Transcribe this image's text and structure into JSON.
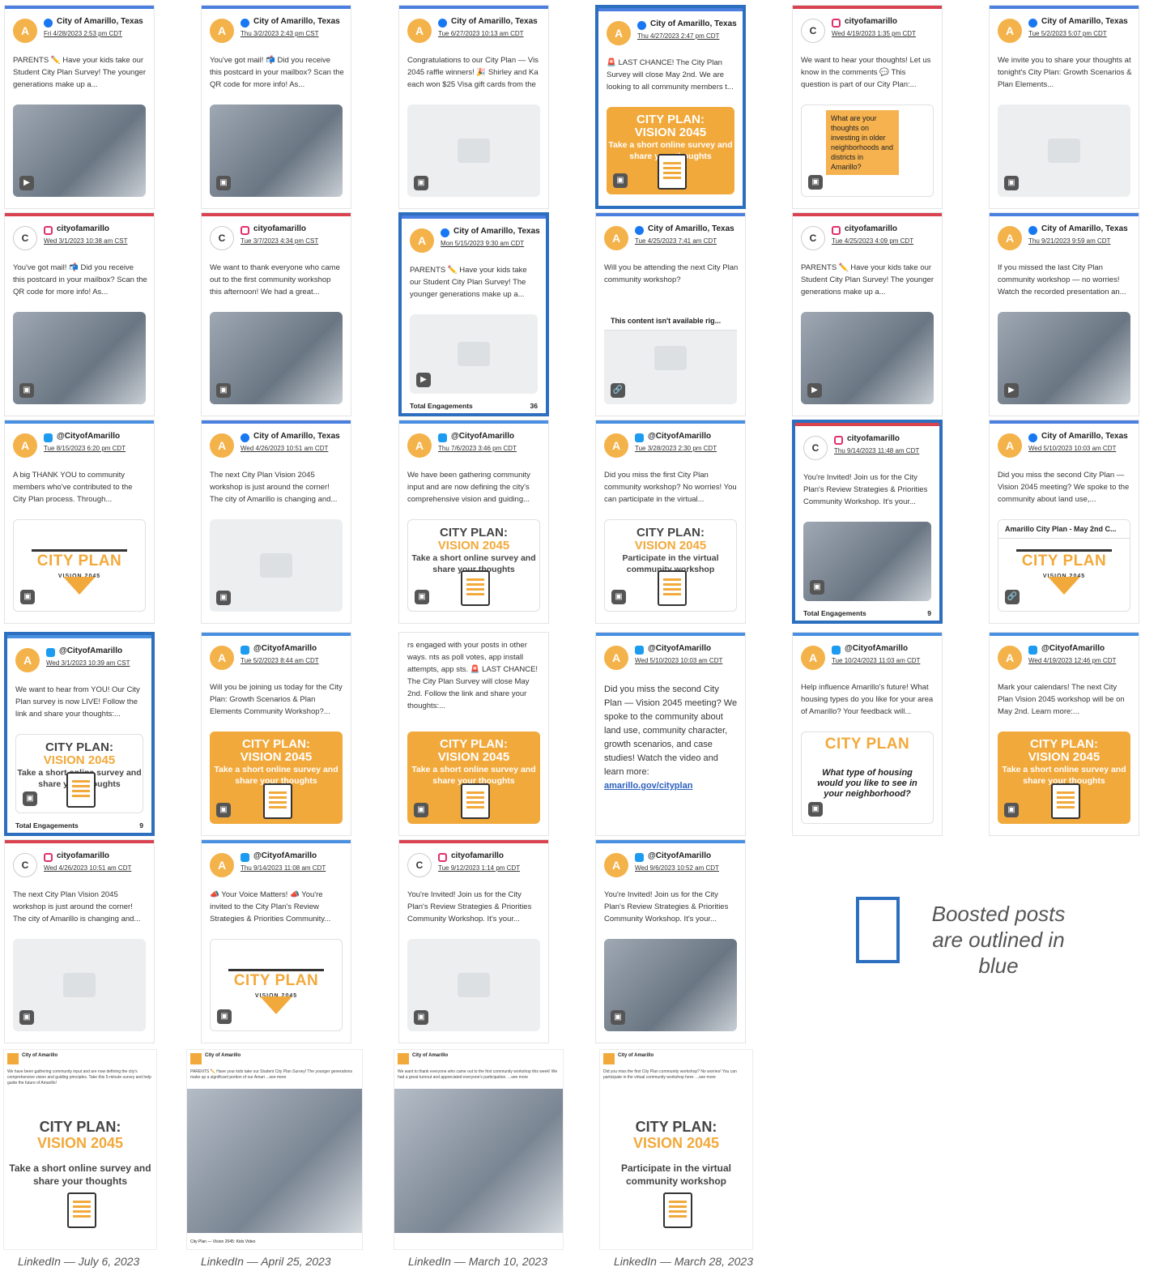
{
  "cards": [
    {
      "net": "fb",
      "acct": "City of Amarillo, Texas",
      "date": "Fri 4/28/2023 2:53 pm CDT",
      "text": "PARENTS ✏️ Have your kids take our Student City Plan Survey! The younger generations make up a...",
      "media": "photo",
      "mtype": "▶"
    },
    {
      "net": "fb",
      "acct": "City of Amarillo, Texas",
      "date": "Thu 3/2/2023 2:43 pm CST",
      "text": "You've got mail! 📬 Did you receive this postcard in your mailbox? Scan the QR code for more info! As...",
      "media": "photo",
      "mtype": "▣"
    },
    {
      "net": "fb",
      "acct": "City of Amarillo, Texas",
      "date": "Tue 6/27/2023 10:13 am CDT",
      "text": "Congratulations to our City Plan — Vis 2045 raffle winners! 🎉 Shirley and Ka each won $25 Visa gift cards from the",
      "media": "blank",
      "mtype": "▣"
    },
    {
      "net": "fb",
      "acct": "City of Amarillo, Texas",
      "date": "Thu 4/27/2023 2:47 pm CDT",
      "text": "🚨 LAST CHANCE! The City Plan Survey will close May 2nd. We are looking to all community members t...",
      "media": "poster",
      "mtype": "▣",
      "boosted": true
    },
    {
      "net": "ig",
      "acct": "cityofamarillo",
      "date": "Wed 4/19/2023 1:35 pm CDT",
      "text": "We want to hear your thoughts! Let us know in the comments 💬 This question is part of our City Plan:...",
      "media": "note",
      "mtype": "▣"
    },
    {
      "net": "fb",
      "acct": "City of Amarillo, Texas",
      "date": "Tue 5/2/2023 5:07 pm CDT",
      "text": "We invite you to share your thoughts at tonight's City Plan: Growth Scenarios & Plan Elements...",
      "media": "blank",
      "mtype": "▣"
    },
    {
      "net": "ig",
      "acct": "cityofamarillo",
      "date": "Wed 3/1/2023 10:38 am CST",
      "text": "You've got mail! 📬 Did you receive this postcard in your mailbox? Scan the QR code for more info! As...",
      "media": "photo",
      "mtype": "▣"
    },
    {
      "net": "ig",
      "acct": "cityofamarillo",
      "date": "Tue 3/7/2023 4:34 pm CST",
      "text": "We want to thank everyone who came out to the first community workshop this afternoon! We had a great...",
      "media": "photo",
      "mtype": "▣"
    },
    {
      "net": "fb",
      "acct": "City of Amarillo, Texas",
      "date": "Mon 5/15/2023 9:30 am CDT",
      "text": "PARENTS ✏️ Have your kids take our Student City Plan Survey! The younger generations make up a...",
      "media": "blank",
      "mtype": "▶",
      "boosted": true,
      "eng_label": "Total Engagements",
      "eng_value": "36"
    },
    {
      "net": "fb",
      "acct": "City of Amarillo, Texas",
      "date": "Tue 4/25/2023 7:41 am CDT",
      "text": "Will you be attending the next City Plan community workshop?",
      "media": "unavail",
      "mtype": "🔗",
      "unavail": "This content isn't available rig..."
    },
    {
      "net": "ig",
      "acct": "cityofamarillo",
      "date": "Tue 4/25/2023 4:09 pm CDT",
      "text": "PARENTS ✏️ Have your kids take our Student City Plan Survey! The younger generations make up a...",
      "media": "photo",
      "mtype": "▶"
    },
    {
      "net": "fb",
      "acct": "City of Amarillo, Texas",
      "date": "Thu 9/21/2023 9:59 am CDT",
      "text": "If you missed the last City Plan community workshop — no worries! Watch the recorded presentation an...",
      "media": "photo",
      "mtype": "▶"
    },
    {
      "net": "tw",
      "acct": "@CityofAmarillo",
      "date": "Tue 8/15/2023 6:20 pm CDT",
      "text": "A big THANK YOU to community members who've contributed to the City Plan process. Through...",
      "media": "logo",
      "mtype": "▣"
    },
    {
      "net": "fb",
      "acct": "City of Amarillo, Texas",
      "date": "Wed 4/26/2023 10:51 am CDT",
      "text": "The next City Plan Vision 2045 workshop is just around the corner! The city of Amarillo is changing and...",
      "media": "blank",
      "mtype": "▣"
    },
    {
      "net": "tw",
      "acct": "@CityofAmarillo",
      "date": "Thu 7/6/2023 3:46 pm CDT",
      "text": "We have been gathering community input and are now defining the city's comprehensive vision and guiding...",
      "media": "posterw",
      "mtype": "▣"
    },
    {
      "net": "tw",
      "acct": "@CityofAmarillo",
      "date": "Tue 3/28/2023 2:30 pm CDT",
      "text": "Did you miss the first City Plan community workshop? No worries! You can participate in the virtual...",
      "media": "posterw2",
      "mtype": "▣"
    },
    {
      "net": "ig",
      "acct": "cityofamarillo",
      "date": "Thu 9/14/2023 11:48 am CDT",
      "text": "You're Invited! Join us for the City Plan's Review Strategies & Priorities Community Workshop. It's your...",
      "media": "photo",
      "mtype": "▣",
      "boosted": true,
      "eng_label": "Total Engagements",
      "eng_value": "9"
    },
    {
      "net": "fb",
      "acct": "City of Amarillo, Texas",
      "date": "Wed 5/10/2023 10:03 am CDT",
      "text": "Did you miss the second City Plan — Vision 2045 meeting? We spoke to the community about land use,...",
      "media": "logo",
      "mtype": "🔗",
      "unavail": "Amarillo City Plan - May 2nd C..."
    },
    {
      "net": "tw",
      "acct": "@CityofAmarillo",
      "date": "Wed 3/1/2023 10:39 am CST",
      "text": "We want to hear from YOU! Our City Plan survey is now LIVE! Follow the link and share your thoughts:...",
      "media": "posterw",
      "mtype": "▣",
      "boosted": true,
      "eng_label": "Total Engagements",
      "eng_value": "9"
    },
    {
      "net": "tw",
      "acct": "@CityofAmarillo",
      "date": "Tue 5/2/2023 8:44 am CDT",
      "text": "Will you be joining us today for the City Plan: Growth Scenarios & Plan Elements Community Workshop?...",
      "media": "poster",
      "mtype": "▣"
    },
    {
      "net": "none",
      "acct": "",
      "date": "",
      "text": "rs engaged with your posts in other ways. nts as poll votes, app install attempts, app sts. 🚨 LAST CHANCE! The City Plan Survey will close May 2nd. Follow the link and share your thoughts:...",
      "media": "poster",
      "mtype": "▣"
    },
    {
      "net": "tw",
      "acct": "@CityofAmarillo",
      "date": "Wed 5/10/2023 10:03 am CDT",
      "text": "",
      "media": "bigtext",
      "mtype": "🔗",
      "big": "Did you miss the second City Plan — Vision 2045 meeting? We spoke to the community about land use, community character, growth scenarios, and case studies! Watch the video and learn more:",
      "biglink": "amarillo.gov/cityplan"
    },
    {
      "net": "tw",
      "acct": "@CityofAmarillo",
      "date": "Tue 10/24/2023 11:03 am CDT",
      "text": "Help influence Amarillo's future! What housing types do you like for your area of Amarillo? Your feedback will...",
      "media": "housing",
      "mtype": "▣",
      "housing": "What type of housing would you like to see in your neighborhood?"
    },
    {
      "net": "tw",
      "acct": "@CityofAmarillo",
      "date": "Wed 4/19/2023 12:46 pm CDT",
      "text": "Mark your calendars! The next City Plan Vision 2045 workshop will be on May 2nd. Learn more:...",
      "media": "poster",
      "mtype": "▣"
    },
    {
      "net": "ig",
      "acct": "cityofamarillo",
      "date": "Wed 4/26/2023 10:51 am CDT",
      "text": "The next City Plan Vision 2045 workshop is just around the corner! The city of Amarillo is changing and...",
      "media": "blank",
      "mtype": "▣"
    },
    {
      "net": "tw",
      "acct": "@CityofAmarillo",
      "date": "Thu 9/14/2023 11:08 am CDT",
      "text": "📣 Your Voice Matters! 📣 You're invited to the City Plan's Review Strategies & Priorities Community...",
      "media": "logo",
      "mtype": "▣"
    },
    {
      "net": "ig",
      "acct": "cityofamarillo",
      "date": "Tue 9/12/2023 1:14 pm CDT",
      "text": "You're Invited! Join us for the City Plan's Review Strategies & Priorities Community Workshop. It's your...",
      "media": "blank",
      "mtype": "▣"
    },
    {
      "net": "tw",
      "acct": "@CityofAmarillo",
      "date": "Wed 9/6/2023 10:52 am CDT",
      "text": "You're Invited! Join us for the City Plan's Review Strategies & Priorities Community Workshop. It's your...",
      "media": "photo",
      "mtype": "▣"
    }
  ],
  "poster": {
    "title1": "CITY PLAN:",
    "title2": "VISION 2045",
    "sub": "Take a short online survey and share your thoughts",
    "sub2": "Participate in the virtual community workshop",
    "logo_title": "CITY PLAN",
    "logo_sub": "VISION 2045",
    "note": "What are your thoughts on investing in older neighborhoods and districts in Amarillo?"
  },
  "legend": {
    "line1": "Boosted posts",
    "line2": "are outlined in blue"
  },
  "linkedin": [
    {
      "caption": "LinkedIn — July 6, 2023",
      "name": "City of Amarillo",
      "snippet": "We have been gathering community input and are now defining the city's comprehensive vision and guiding principles. Take this 5-minute survey and help guide the future of Amarillo!",
      "kind": "poster"
    },
    {
      "caption": "LinkedIn — April 25, 2023",
      "name": "City of Amarillo",
      "snippet": "PARENTS ✏️ Have your kids take our Student City Plan Survey! The younger generations make up a significant portion of our Amari ...see more",
      "kind": "photo",
      "foot": "City Plan — Vision 2045: Kids Video"
    },
    {
      "caption": "LinkedIn — March 10, 2023",
      "name": "City of Amarillo",
      "snippet": "We want to thank everyone who came out to the first community workshop this week! We had a great turnout and appreciated everyone's participation. ...see more",
      "kind": "photo"
    },
    {
      "caption": "LinkedIn — March 28, 2023",
      "name": "City of Amarillo",
      "snippet": "Did you miss the first City Plan community workshop? No worries! You can participate in the virtual community workshop here: ...see more",
      "kind": "poster2"
    }
  ]
}
